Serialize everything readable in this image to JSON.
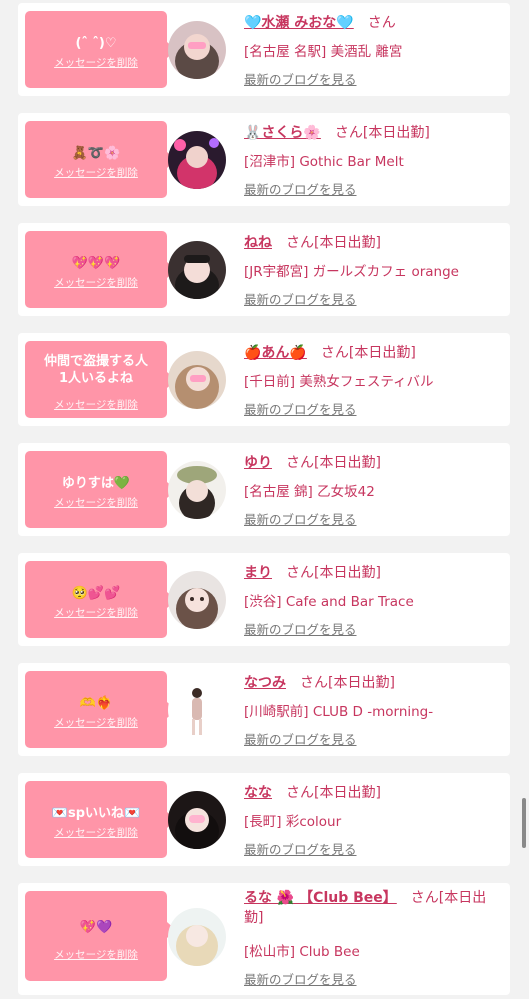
{
  "colors": {
    "accent": "#c7365f",
    "bubble": "#ff95a8",
    "background": "#f2f2f2",
    "link_gray": "#777777"
  },
  "delete_label": "メッセージを削除",
  "blog_label": "最新のブログを見る",
  "san_label": "さん",
  "entries": [
    {
      "message": "(ˆ ˆ)♡",
      "name": "🩵水瀬 みおな🩵",
      "status": "さん",
      "shop": "[名古屋 名駅] 美酒乱 離宮"
    },
    {
      "message": "🧸➰🌸",
      "name": "🐰さくら🌸",
      "status": "さん[本日出勤]",
      "shop": "[沼津市] Gothic Bar Melt"
    },
    {
      "message": "💖💖💖",
      "name": "ねね",
      "status": "さん[本日出勤]",
      "shop": "[JR宇都宮] ガールズカフェ orange"
    },
    {
      "message": "仲間で盗撮する人\n1人いるよね",
      "name": "🍎あん🍎",
      "status": "さん[本日出勤]",
      "shop": "[千日前] 美熟女フェスティバル"
    },
    {
      "message": "ゆりすは💚",
      "name": "ゆり",
      "status": "さん[本日出勤]",
      "shop": "[名古屋 錦] 乙女坂42"
    },
    {
      "message": "🥺💕💕",
      "name": "まり",
      "status": "さん[本日出勤]",
      "shop": "[渋谷] Cafe and Bar Trace"
    },
    {
      "message": "🫶❤️‍🔥",
      "name": "なつみ",
      "status": "さん[本日出勤]",
      "shop": "[川崎駅前] CLUB D -morning-"
    },
    {
      "message": "💌spいいね💌",
      "name": "なな",
      "status": "さん[本日出勤]",
      "shop": "[長町] 彩colour"
    },
    {
      "message": "💖💜",
      "name": "るな 🌺 【Club Bee】",
      "status": "さん[本日出勤]",
      "shop": "[松山市] Club Bee"
    }
  ]
}
